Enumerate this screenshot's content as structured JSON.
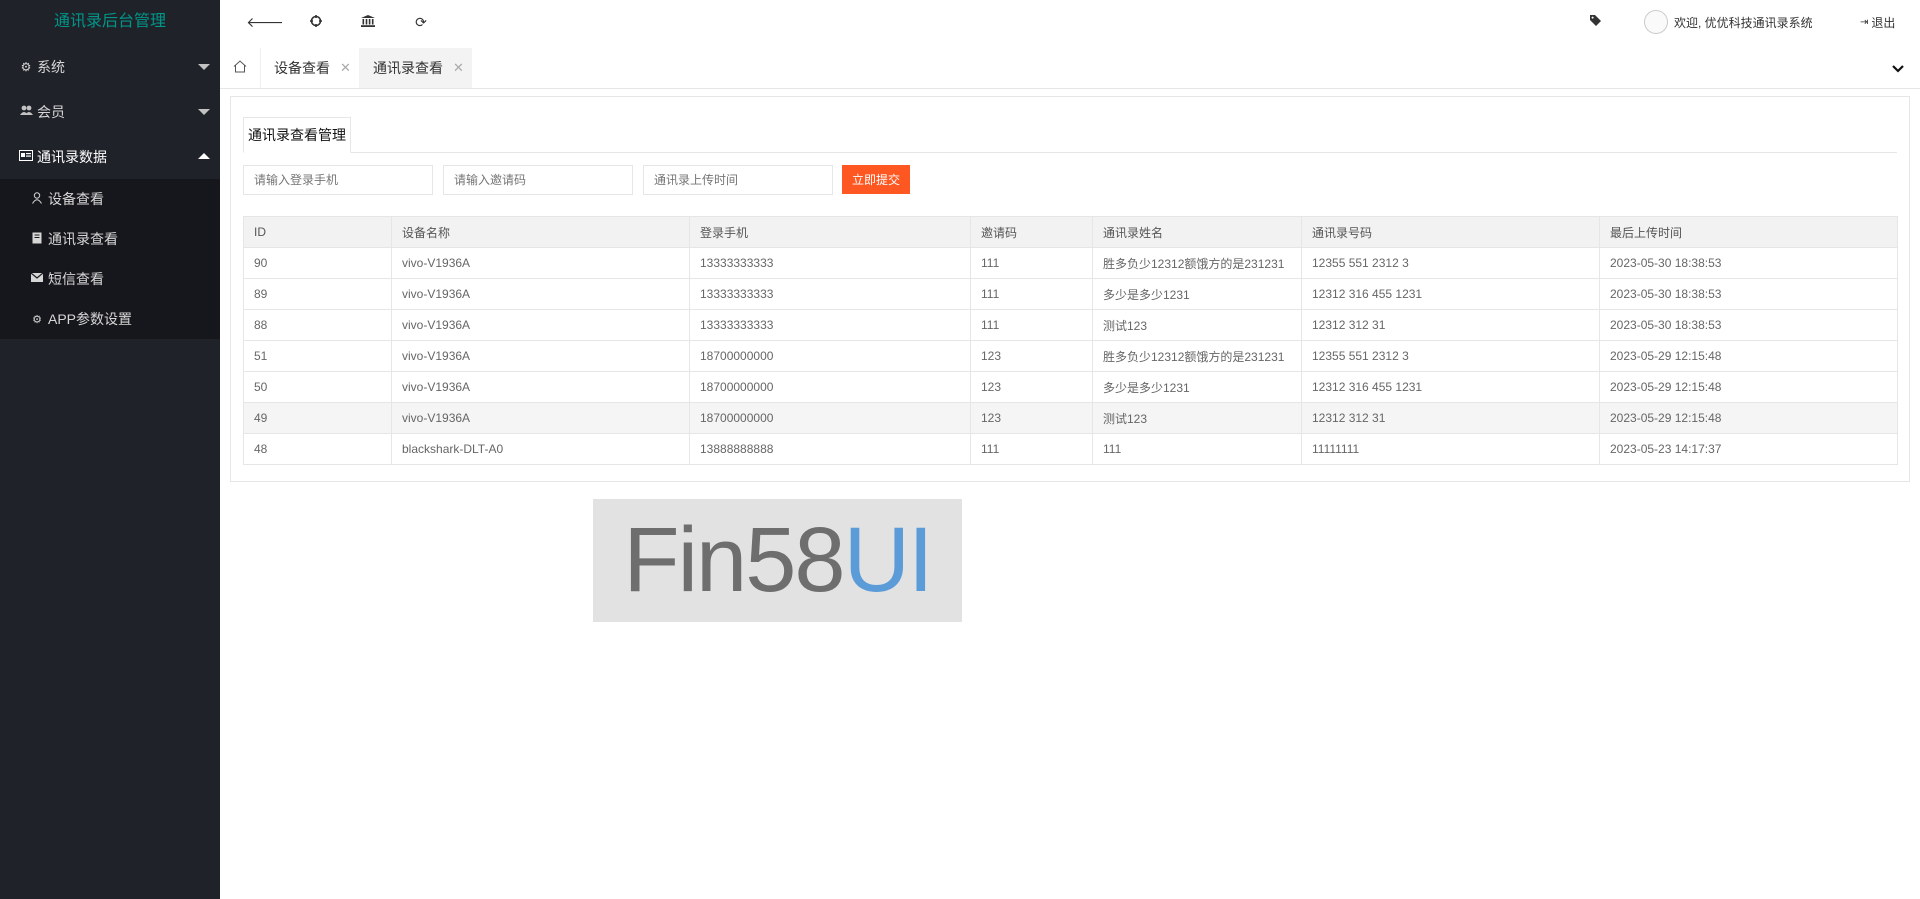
{
  "app": {
    "title": "通讯录后台管理"
  },
  "sidebar": {
    "groups": [
      {
        "label": "系统",
        "icon": "gear-icon"
      },
      {
        "label": "会员",
        "icon": "users-icon"
      },
      {
        "label": "通讯录数据",
        "icon": "id-card-icon"
      }
    ],
    "sub_items": [
      {
        "label": "设备查看",
        "icon": "user-icon"
      },
      {
        "label": "通讯录查看",
        "icon": "book-icon"
      },
      {
        "label": "短信查看",
        "icon": "envelope-icon"
      },
      {
        "label": "APP参数设置",
        "icon": "gear-icon"
      }
    ]
  },
  "header": {
    "user_greeting": "欢迎, 优优科技通讯录系统",
    "logout_label": "退出"
  },
  "tabs": [
    {
      "label": "设备查看"
    },
    {
      "label": "通讯录查看"
    }
  ],
  "panel": {
    "title": "通讯录查看管理"
  },
  "search": {
    "phone_placeholder": "请输入登录手机",
    "code_placeholder": "请输入邀请码",
    "time_placeholder": "通讯录上传时间",
    "submit_label": "立即提交"
  },
  "table": {
    "headers": [
      "ID",
      "设备名称",
      "登录手机",
      "邀请码",
      "通讯录姓名",
      "通讯录号码",
      "最后上传时间"
    ],
    "rows": [
      [
        "90",
        "vivo-V1936A",
        "13333333333",
        "111",
        "胜多负少12312额饿方的是231231",
        "12355 551 2312 3",
        "2023-05-30 18:38:53"
      ],
      [
        "89",
        "vivo-V1936A",
        "13333333333",
        "111",
        "多少是多少1231",
        "12312 316 455 1231",
        "2023-05-30 18:38:53"
      ],
      [
        "88",
        "vivo-V1936A",
        "13333333333",
        "111",
        "测试123",
        "12312 312 31",
        "2023-05-30 18:38:53"
      ],
      [
        "51",
        "vivo-V1936A",
        "18700000000",
        "123",
        "胜多负少12312额饿方的是231231",
        "12355 551 2312 3",
        "2023-05-29 12:15:48"
      ],
      [
        "50",
        "vivo-V1936A",
        "18700000000",
        "123",
        "多少是多少1231",
        "12312 316 455 1231",
        "2023-05-29 12:15:48"
      ],
      [
        "49",
        "vivo-V1936A",
        "18700000000",
        "123",
        "测试123",
        "12312 312 31",
        "2023-05-29 12:15:48"
      ],
      [
        "48",
        "blackshark-DLT-A0",
        "13888888888",
        "111",
        "111",
        "11111111",
        "2023-05-23 14:17:37"
      ]
    ]
  },
  "watermark": {
    "part1": "Fin58",
    "part2": "UI"
  },
  "colors": {
    "sidebar_bg": "#20222a",
    "logo": "#009688",
    "submit": "#ff5722"
  }
}
